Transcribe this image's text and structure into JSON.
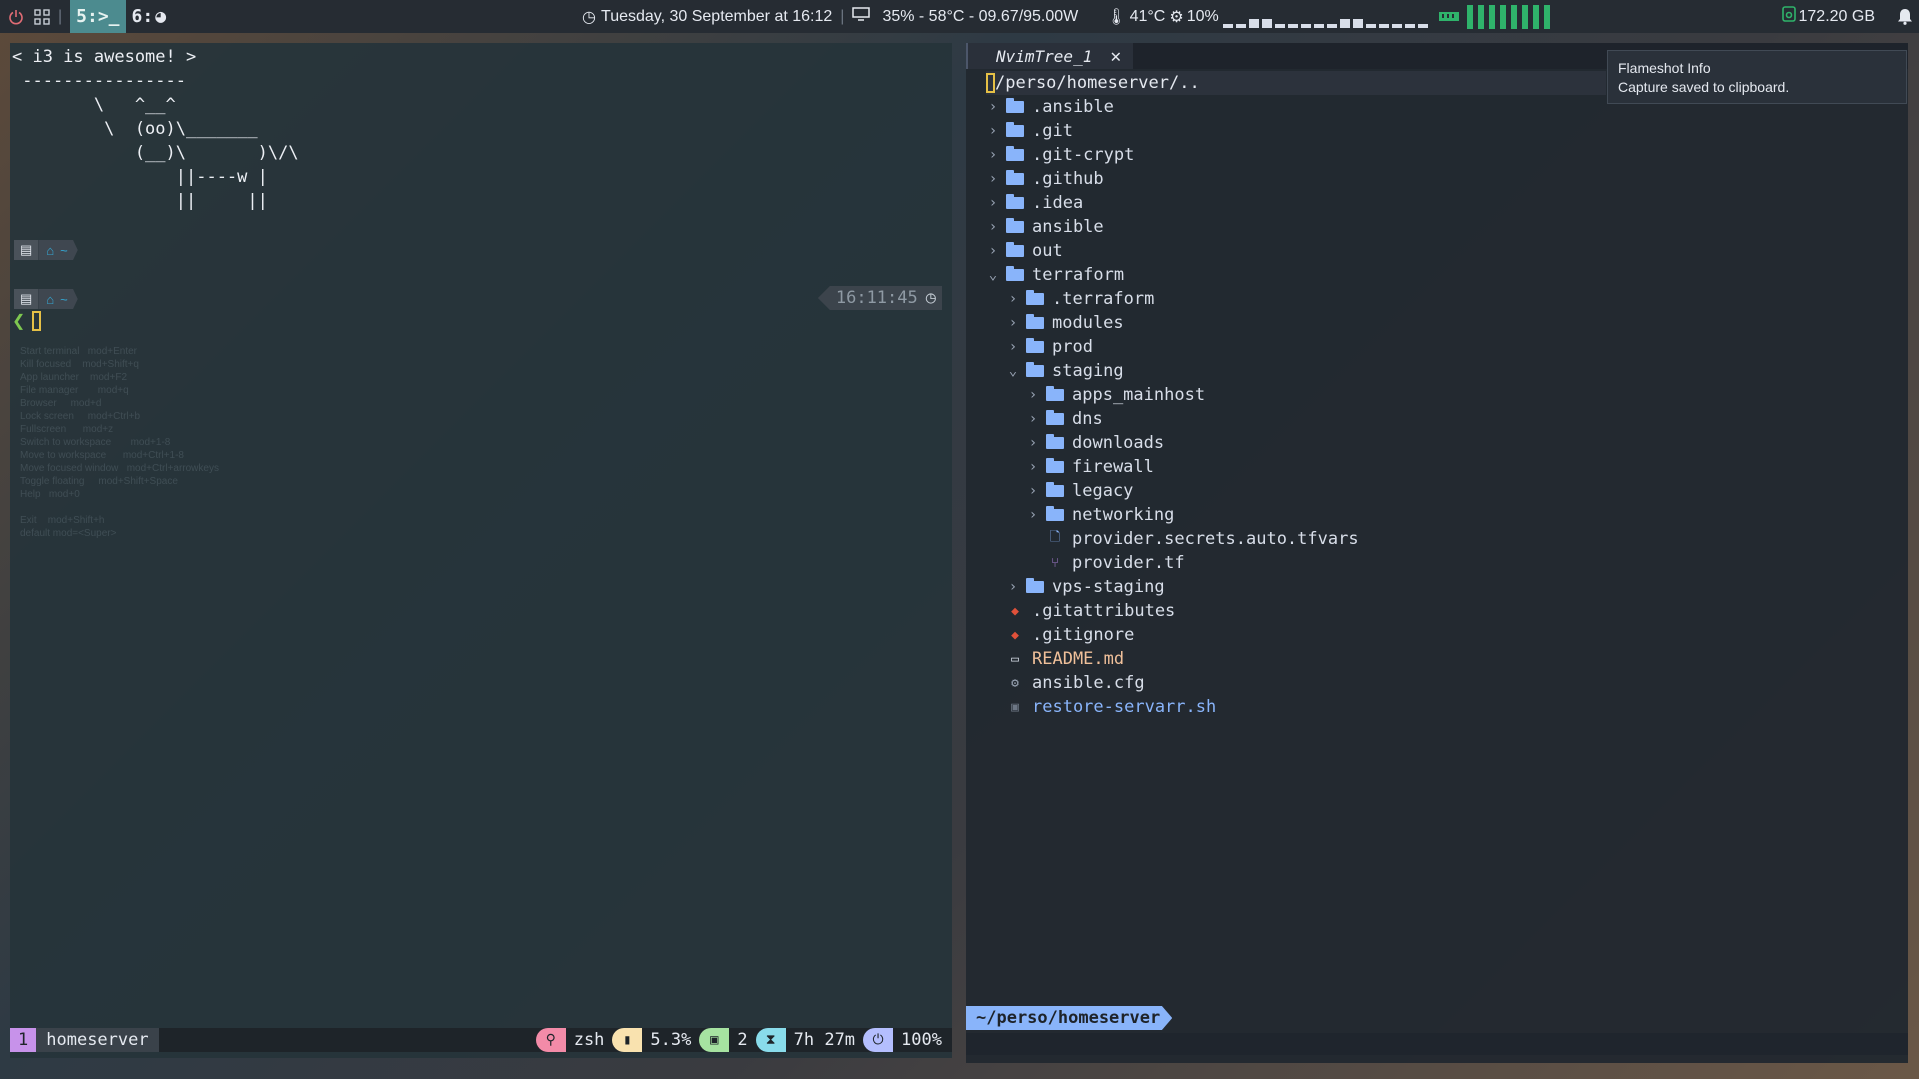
{
  "topbar": {
    "workspace_active": "5:>_",
    "workspace_other": "6:",
    "datetime": "Tuesday, 30 September at 16:12",
    "gpu": "35%  -  58°C  - 09.67/95.00W",
    "temp": "41°C",
    "cpu": "10%",
    "cpu_graph": [
      0.2,
      0.2,
      0.4,
      0.4,
      0.2,
      0.2,
      0.2,
      0.2,
      0.2,
      0.4,
      0.4,
      0.2,
      0.2,
      0.2,
      0.2,
      0.2
    ],
    "memory_bars": 8,
    "disk": "172.20 GB",
    "accent_color": "#4c8b8f"
  },
  "terminal": {
    "cowsay": "< i3 is awesome! >\n ----------------\n        \\   ^__^\n         \\  (oo)\\_______\n            (__)\\       )\\/\\\n                ||----w |\n                ||     ||",
    "prompt_home": "~",
    "time_badge": "16:11:45",
    "prompt_char": "❮",
    "hints": "Start terminal   mod+Enter\nKill focused    mod+Shift+q\nApp launcher    mod+F2\nFile manager       mod+q\nBrowser     mod+d\nLock screen     mod+Ctrl+b\nFullscreen      mod+z\nSwitch to workspace       mod+1-8\nMove to workspace      mod+Ctrl+1-8\nMove focused window   mod+Ctrl+arrowkeys\nToggle floating     mod+Shift+Space\nHelp   mod+0\n\nExit    mod+Shift+h\ndefault mod=<Super>"
  },
  "tmux": {
    "window_number": "1",
    "session_name": "homeserver",
    "shell": "zsh",
    "cpu": "5.3%",
    "panes": "2",
    "uptime": "7h 27m",
    "battery": "100%"
  },
  "nvim": {
    "tab_title": "NvimTree_1",
    "cwd": "/perso/homeserver/..",
    "tree": [
      {
        "depth": 0,
        "kind": "dir",
        "open": false,
        "name": ".ansible"
      },
      {
        "depth": 0,
        "kind": "dir",
        "open": false,
        "name": ".git"
      },
      {
        "depth": 0,
        "kind": "dir",
        "open": false,
        "name": ".git-crypt"
      },
      {
        "depth": 0,
        "kind": "dir",
        "open": false,
        "name": ".github"
      },
      {
        "depth": 0,
        "kind": "dir",
        "open": false,
        "name": ".idea"
      },
      {
        "depth": 0,
        "kind": "dir",
        "open": false,
        "name": "ansible"
      },
      {
        "depth": 0,
        "kind": "dir",
        "open": false,
        "name": "out"
      },
      {
        "depth": 0,
        "kind": "dir",
        "open": true,
        "name": "terraform"
      },
      {
        "depth": 1,
        "kind": "dir",
        "open": false,
        "name": ".terraform"
      },
      {
        "depth": 1,
        "kind": "dir",
        "open": false,
        "name": "modules"
      },
      {
        "depth": 1,
        "kind": "dir",
        "open": false,
        "name": "prod"
      },
      {
        "depth": 1,
        "kind": "dir",
        "open": true,
        "name": "staging"
      },
      {
        "depth": 2,
        "kind": "dir",
        "open": false,
        "name": "apps_mainhost"
      },
      {
        "depth": 2,
        "kind": "dir",
        "open": false,
        "name": "dns"
      },
      {
        "depth": 2,
        "kind": "dir",
        "open": false,
        "name": "downloads"
      },
      {
        "depth": 2,
        "kind": "dir",
        "open": false,
        "name": "firewall"
      },
      {
        "depth": 2,
        "kind": "dir",
        "open": false,
        "name": "legacy"
      },
      {
        "depth": 2,
        "kind": "dir",
        "open": false,
        "name": "networking"
      },
      {
        "depth": 2,
        "kind": "file",
        "icon": "file-icon",
        "glyph": "🗋",
        "color": "#89b4fa",
        "name": "provider.secrets.auto.tfvars"
      },
      {
        "depth": 2,
        "kind": "file",
        "icon": "terraform-icon",
        "glyph": "⑂",
        "color": "#a87dd6",
        "name": "provider.tf"
      },
      {
        "depth": 1,
        "kind": "dir",
        "open": false,
        "name": "vps-staging"
      },
      {
        "depth": 0,
        "kind": "file",
        "icon": "git-icon",
        "glyph": "◆",
        "color": "#e0513a",
        "name": ".gitattributes"
      },
      {
        "depth": 0,
        "kind": "file",
        "icon": "git-icon",
        "glyph": "◆",
        "color": "#e0513a",
        "name": ".gitignore"
      },
      {
        "depth": 0,
        "kind": "file",
        "icon": "markdown-icon",
        "glyph": "▭",
        "color": "#d8dee9",
        "name": "README.md",
        "name_color": "#f0c09a"
      },
      {
        "depth": 0,
        "kind": "file",
        "icon": "gear-icon",
        "glyph": "⚙",
        "color": "#9aa5b5",
        "name": "ansible.cfg"
      },
      {
        "depth": 0,
        "kind": "file",
        "icon": "terminal-icon",
        "glyph": "▣",
        "color": "#6c7684",
        "name": "restore-servarr.sh",
        "name_color": "#89b4fa"
      }
    ],
    "statusline_path": "~/perso/homeserver"
  },
  "notification": {
    "title": "Flameshot Info",
    "message": "Capture saved to clipboard."
  }
}
